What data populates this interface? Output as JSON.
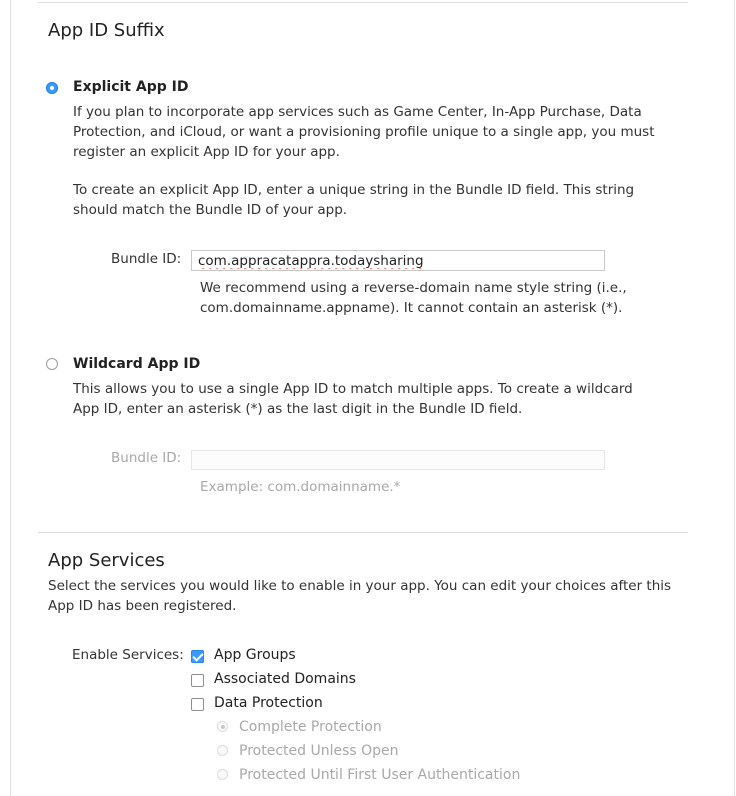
{
  "suffix_section": {
    "title": "App ID Suffix",
    "explicit": {
      "label": "Explicit App ID",
      "selected": true,
      "description_1": "If you plan to incorporate app services such as Game Center, In-App Purchase, Data Protection, and iCloud, or want a provisioning profile unique to a single app, you must register an explicit App ID for your app.",
      "description_2": "To create an explicit App ID, enter a unique string in the Bundle ID field. This string should match the Bundle ID of your app.",
      "bundle_label": "Bundle ID:",
      "bundle_value": "com.appracatappra.todaysharing",
      "hint": "We recommend using a reverse-domain name style string (i.e., com.domainname.appname). It cannot contain an asterisk (*)."
    },
    "wildcard": {
      "label": "Wildcard App ID",
      "selected": false,
      "description": "This allows you to use a single App ID to match multiple apps. To create a wildcard App ID, enter an asterisk (*) as the last digit in the Bundle ID field.",
      "bundle_label": "Bundle ID:",
      "bundle_value": "",
      "example": "Example: com.domainname.*"
    }
  },
  "services_section": {
    "title": "App Services",
    "description": "Select the services you would like to enable in your app. You can edit your choices after this App ID has been registered.",
    "enable_label": "Enable Services:",
    "services": [
      {
        "label": "App Groups",
        "checked": true
      },
      {
        "label": "Associated Domains",
        "checked": false
      },
      {
        "label": "Data Protection",
        "checked": false
      }
    ],
    "data_protection_options": [
      {
        "label": "Complete Protection",
        "selected": true
      },
      {
        "label": "Protected Unless Open",
        "selected": false
      },
      {
        "label": "Protected Until First User Authentication",
        "selected": false
      }
    ]
  },
  "colors": {
    "accent": "#3b99fc",
    "text": "#333333",
    "disabled_text": "#a8a8a8",
    "divider": "#dcdcdc",
    "spellcheck": "#e0443a"
  }
}
